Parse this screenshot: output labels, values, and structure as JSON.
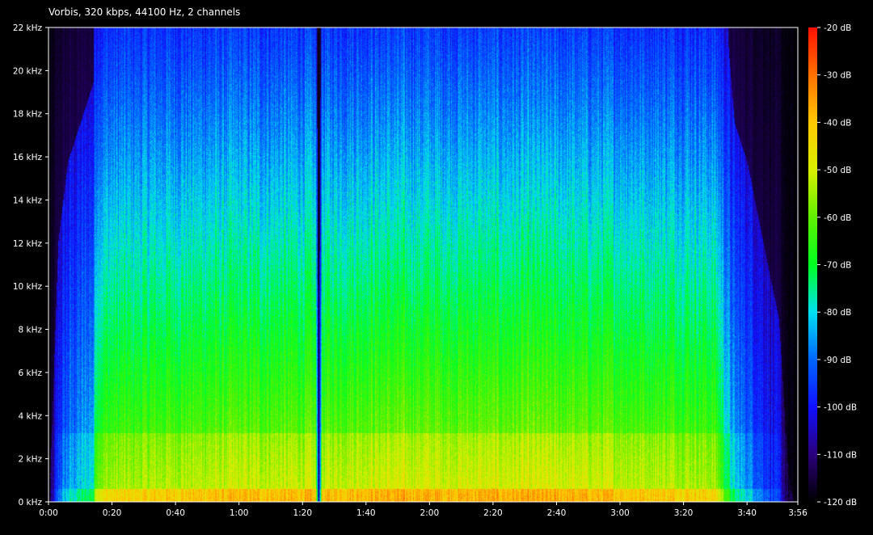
{
  "title": "Vorbis, 320 kbps, 44100 Hz, 2 channels",
  "chart_data": {
    "type": "heatmap",
    "title": "Vorbis, 320 kbps, 44100 Hz, 2 channels",
    "x_axis": {
      "unit": "time",
      "range_seconds": [
        0,
        236
      ],
      "ticks": [
        {
          "label": "0:00",
          "seconds": 0
        },
        {
          "label": "0:20",
          "seconds": 20
        },
        {
          "label": "0:40",
          "seconds": 40
        },
        {
          "label": "1:00",
          "seconds": 60
        },
        {
          "label": "1:20",
          "seconds": 80
        },
        {
          "label": "1:40",
          "seconds": 100
        },
        {
          "label": "2:00",
          "seconds": 120
        },
        {
          "label": "2:20",
          "seconds": 140
        },
        {
          "label": "2:40",
          "seconds": 160
        },
        {
          "label": "3:00",
          "seconds": 180
        },
        {
          "label": "3:20",
          "seconds": 200
        },
        {
          "label": "3:40",
          "seconds": 220
        },
        {
          "label": "3:56",
          "seconds": 236
        }
      ]
    },
    "y_axis": {
      "unit": "kHz",
      "range": [
        0,
        22
      ],
      "ticks": [
        {
          "label": "0 kHz",
          "value": 0
        },
        {
          "label": "2 kHz",
          "value": 2
        },
        {
          "label": "4 kHz",
          "value": 4
        },
        {
          "label": "6 kHz",
          "value": 6
        },
        {
          "label": "8 kHz",
          "value": 8
        },
        {
          "label": "10 kHz",
          "value": 10
        },
        {
          "label": "12 kHz",
          "value": 12
        },
        {
          "label": "14 kHz",
          "value": 14
        },
        {
          "label": "16 kHz",
          "value": 16
        },
        {
          "label": "18 kHz",
          "value": 18
        },
        {
          "label": "20 kHz",
          "value": 20
        },
        {
          "label": "22 kHz",
          "value": 22
        }
      ]
    },
    "color_scale": {
      "unit": "dB",
      "range": [
        -120,
        -20
      ],
      "ticks": [
        {
          "label": "-20 dB",
          "value": -20
        },
        {
          "label": "-30 dB",
          "value": -30
        },
        {
          "label": "-40 dB",
          "value": -40
        },
        {
          "label": "-50 dB",
          "value": -50
        },
        {
          "label": "-60 dB",
          "value": -60
        },
        {
          "label": "-70 dB",
          "value": -70
        },
        {
          "label": "-80 dB",
          "value": -80
        },
        {
          "label": "-90 dB",
          "value": -90
        },
        {
          "label": "-100 dB",
          "value": -100
        },
        {
          "label": "-110 dB",
          "value": -110
        },
        {
          "label": "-120 dB",
          "value": -120
        }
      ],
      "colors": [
        {
          "db": -120,
          "color": "#000000"
        },
        {
          "db": -110,
          "color": "#2a007a"
        },
        {
          "db": -100,
          "color": "#1010ff"
        },
        {
          "db": -90,
          "color": "#0066ff"
        },
        {
          "db": -80,
          "color": "#00e0f0"
        },
        {
          "db": -70,
          "color": "#00ff20"
        },
        {
          "db": -60,
          "color": "#60f000"
        },
        {
          "db": -50,
          "color": "#d8f000"
        },
        {
          "db": -40,
          "color": "#ffc800"
        },
        {
          "db": -30,
          "color": "#ff7000"
        },
        {
          "db": -20,
          "color": "#ff1000"
        }
      ]
    },
    "grid": false,
    "legend_placement": "right",
    "intensity_profile": {
      "time_seconds": [
        0,
        3,
        6,
        10,
        14,
        15,
        20,
        40,
        60,
        80,
        84,
        85,
        86,
        88,
        100,
        120,
        140,
        160,
        180,
        200,
        210,
        214,
        216,
        220,
        230,
        233,
        236
      ],
      "relative_level": [
        0.0,
        0.35,
        0.45,
        0.5,
        0.55,
        0.82,
        0.85,
        0.88,
        0.9,
        0.9,
        0.9,
        0.12,
        0.88,
        0.9,
        0.92,
        0.92,
        0.92,
        0.92,
        0.9,
        0.88,
        0.86,
        0.6,
        0.5,
        0.45,
        0.25,
        0.05,
        0.0
      ]
    },
    "annotations": [
      {
        "type": "dropout",
        "time_seconds": 86
      }
    ]
  }
}
